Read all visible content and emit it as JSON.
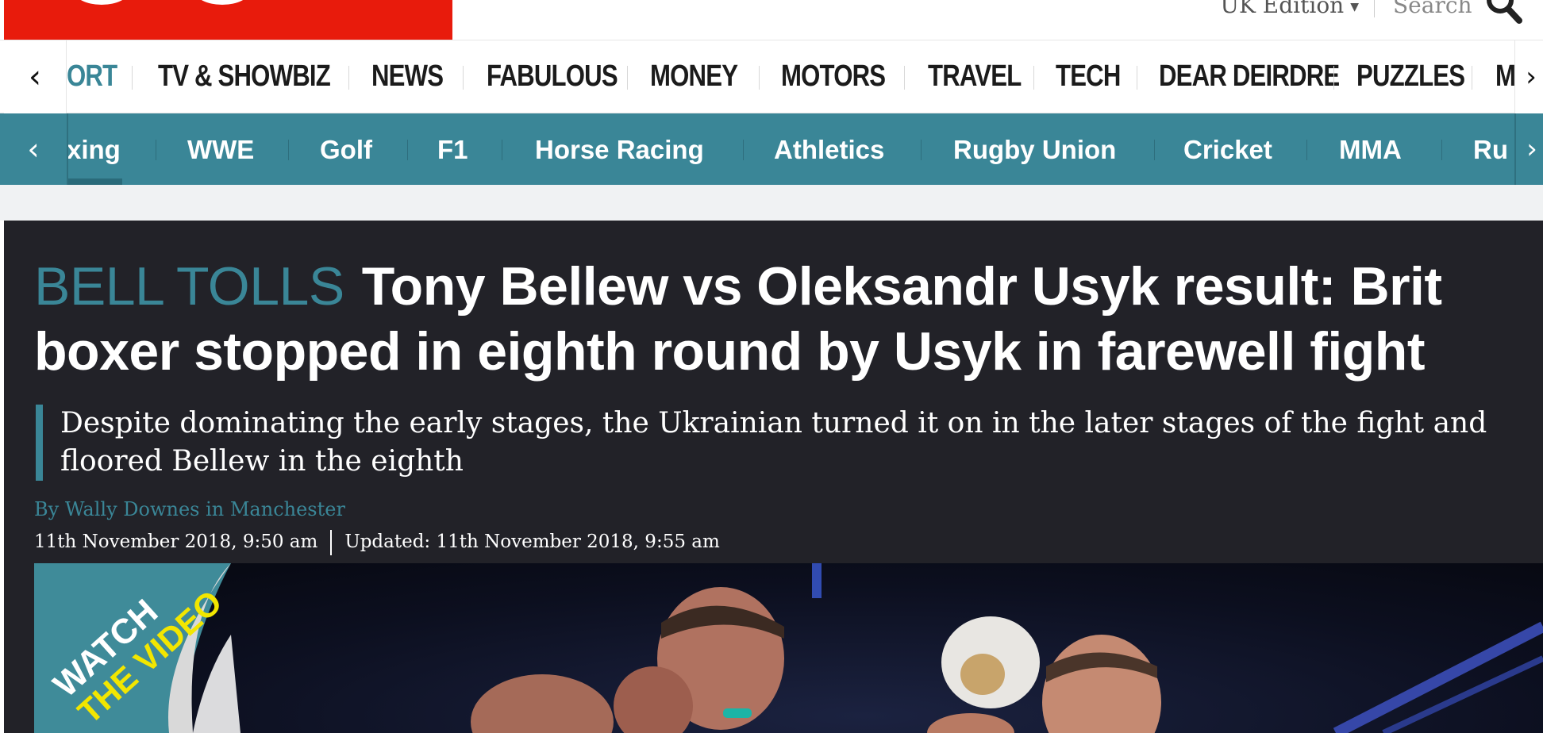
{
  "header": {
    "edition_label": "UK Edition",
    "search_label": "Search"
  },
  "main_nav": {
    "items": [
      "ORT",
      "TV & SHOWBIZ",
      "NEWS",
      "FABULOUS",
      "MONEY",
      "MOTORS",
      "TRAVEL",
      "TECH",
      "DEAR DEIRDRE",
      "PUZZLES",
      "M"
    ],
    "active_index": 0
  },
  "sub_nav": {
    "items": [
      "xing",
      "WWE",
      "Golf",
      "F1",
      "Horse Racing",
      "Athletics",
      "Rugby Union",
      "Cricket",
      "MMA",
      "Ru"
    ],
    "active_index": 0
  },
  "article": {
    "kicker": "BELL TOLLS",
    "headline": "Tony Bellew vs Oleksandr Usyk result: Brit boxer stopped in eighth round by Usyk in farewell fight",
    "standfirst_line1": "Despite dominating the early stages, the Ukrainian turned it on in the later stages of the fight and",
    "standfirst_line2": "floored Bellew in the eighth",
    "byline": "By Wally Downes in Manchester",
    "published": "11th November 2018, 9:50 am",
    "updated": "Updated: 11th November 2018, 9:55 am",
    "video_badge_line1": "WATCH",
    "video_badge_line2": "THE VIDEO"
  },
  "colors": {
    "brand_red": "#e81b0c",
    "sport_teal": "#3a8697",
    "article_bg": "#222228",
    "badge_yellow": "#f2e600"
  }
}
